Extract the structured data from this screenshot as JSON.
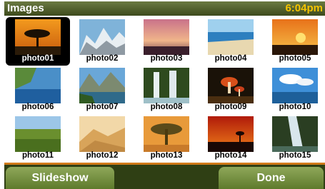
{
  "header": {
    "title": "Images",
    "time": "6:04pm"
  },
  "photos": [
    {
      "label": "photo01"
    },
    {
      "label": "photo02"
    },
    {
      "label": "photo03"
    },
    {
      "label": "photo04"
    },
    {
      "label": "photo05"
    },
    {
      "label": "photo06"
    },
    {
      "label": "photo07"
    },
    {
      "label": "photo08"
    },
    {
      "label": "photo09"
    },
    {
      "label": "photo10"
    },
    {
      "label": "photo11"
    },
    {
      "label": "photo12"
    },
    {
      "label": "photo13"
    },
    {
      "label": "photo14"
    },
    {
      "label": "photo15"
    }
  ],
  "selected_photo": "photo01",
  "footer": {
    "slideshow_label": "Slideshow",
    "done_label": "Done"
  },
  "colors": {
    "header_bg": "#3d4a1c",
    "clock": "#f5c400",
    "accent_line": "#d07a1a",
    "button": "#7a9444",
    "footer_bg": "#2f3f14"
  }
}
